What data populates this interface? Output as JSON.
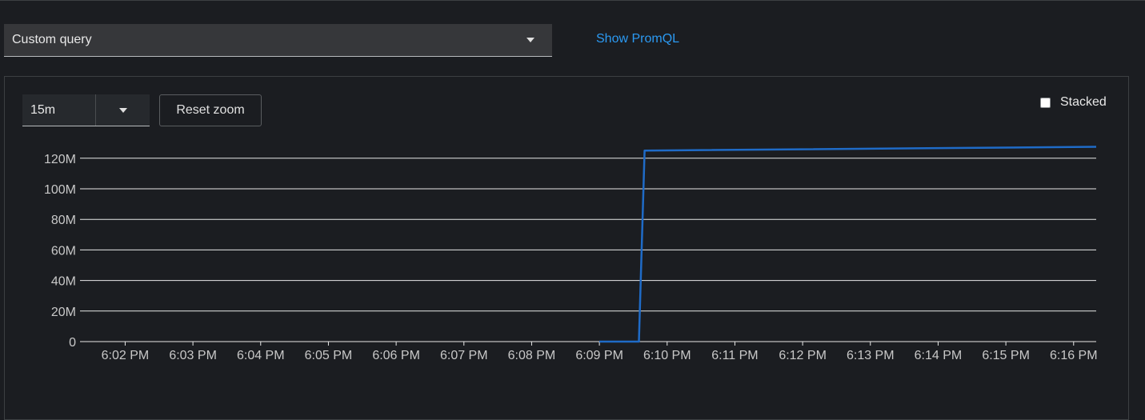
{
  "query_select": {
    "label": "Custom query",
    "icon": "caret-down-icon"
  },
  "show_promql": {
    "label": "Show PromQL",
    "color": "#2b9af3"
  },
  "time_range": {
    "value": "15m",
    "icon": "caret-down-icon"
  },
  "reset_zoom": {
    "label": "Reset zoom"
  },
  "stacked": {
    "label": "Stacked",
    "checked": false
  },
  "colors": {
    "background": "#1b1d21",
    "series": "#1f6bc7",
    "gridline": "#e8e8e8",
    "link": "#2b9af3"
  },
  "chart_data": {
    "type": "line",
    "title": "",
    "xlabel": "",
    "ylabel": "",
    "ylim": [
      0,
      130000000
    ],
    "y_ticks": [
      0,
      20000000,
      40000000,
      60000000,
      80000000,
      100000000,
      120000000
    ],
    "y_tick_labels": [
      "0",
      "20M",
      "40M",
      "60M",
      "80M",
      "100M",
      "120M"
    ],
    "x_range": [
      "6:01:20 PM",
      "6:16:20 PM"
    ],
    "x_tick_labels": [
      "6:02 PM",
      "6:03 PM",
      "6:04 PM",
      "6:05 PM",
      "6:06 PM",
      "6:07 PM",
      "6:08 PM",
      "6:09 PM",
      "6:10 PM",
      "6:11 PM",
      "6:12 PM",
      "6:13 PM",
      "6:14 PM",
      "6:15 PM",
      "6:16 PM"
    ],
    "grid": true,
    "legend": "none",
    "series": [
      {
        "x": [
          "6:09:00 PM",
          "6:09:35 PM",
          "6:09:40 PM",
          "6:16:20 PM"
        ],
        "values": [
          0,
          0,
          125000000,
          127500000
        ]
      }
    ]
  }
}
